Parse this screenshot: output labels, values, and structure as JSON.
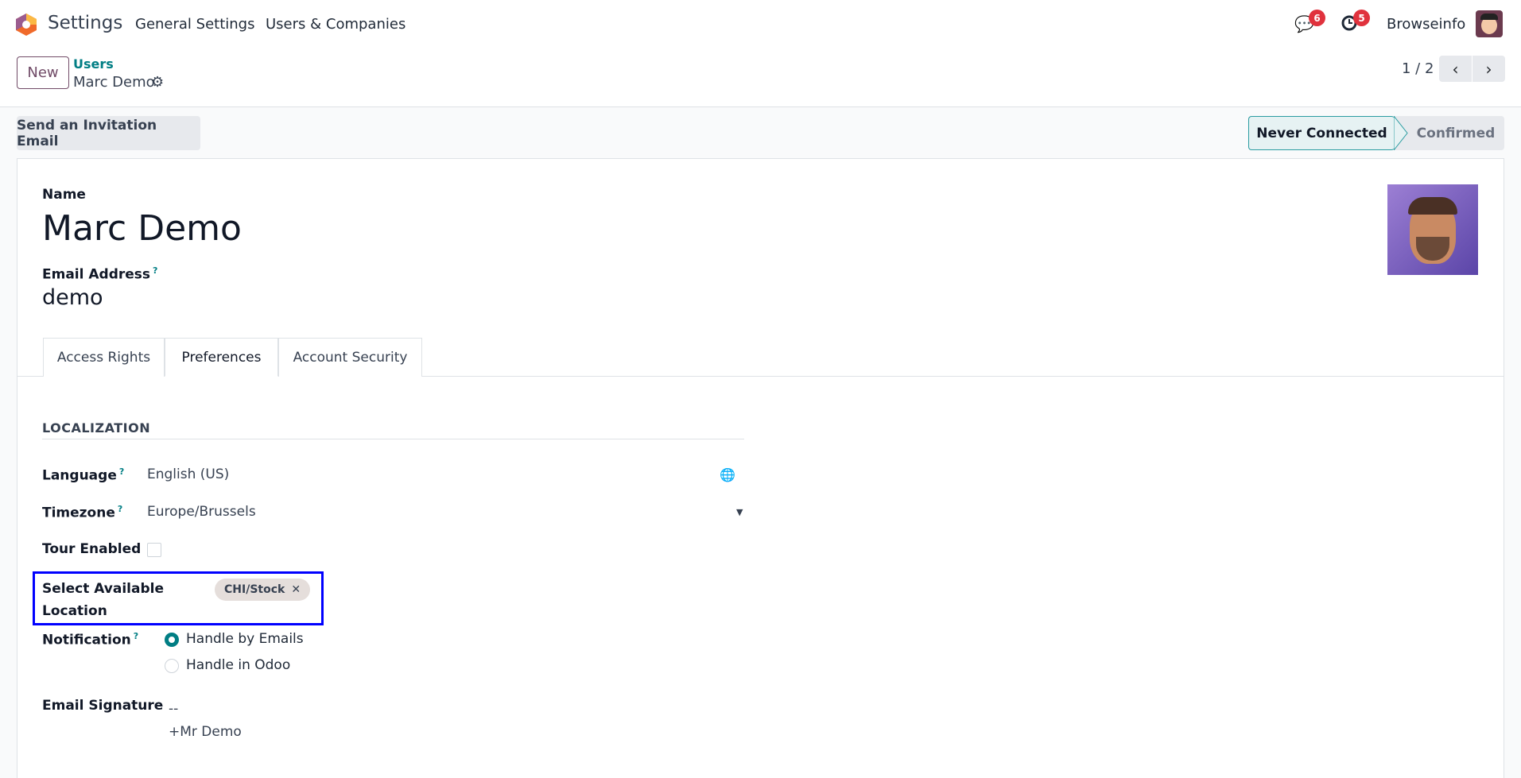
{
  "nav": {
    "app": "Settings",
    "menu": [
      "General Settings",
      "Users & Companies"
    ],
    "messages_count": "6",
    "activities_count": "5",
    "company": "Browseinfo"
  },
  "control": {
    "new_label": "New",
    "breadcrumb_parent": "Users",
    "breadcrumb_current": "Marc Demo",
    "pager": "1 / 2"
  },
  "statusbar": {
    "invite_label": "Send an Invitation Email",
    "states": [
      "Never Connected",
      "Confirmed"
    ],
    "active": "Never Connected"
  },
  "form": {
    "name_label": "Name",
    "name": "Marc Demo",
    "email_label": "Email Address",
    "email_help": "?",
    "email": "demo",
    "tabs": [
      "Access Rights",
      "Preferences",
      "Account Security"
    ],
    "active_tab": "Preferences",
    "section": "LOCALIZATION",
    "language_label": "Language",
    "language": "English (US)",
    "timezone_label": "Timezone",
    "timezone": "Europe/Brussels",
    "tour_label": "Tour Enabled",
    "tour_enabled": false,
    "location_label": "Select Available Location",
    "location_tag": "CHI/Stock",
    "notification_label": "Notification",
    "notification_options": [
      "Handle by Emails",
      "Handle in Odoo"
    ],
    "notification_selected": "Handle by Emails",
    "signature_label": "Email Signature",
    "signature_lines": [
      "--",
      "+Mr Demo"
    ],
    "help": "?"
  },
  "colors": {
    "accent": "#017e84",
    "brand": "#714b67",
    "highlight_box": "#0000ff"
  }
}
